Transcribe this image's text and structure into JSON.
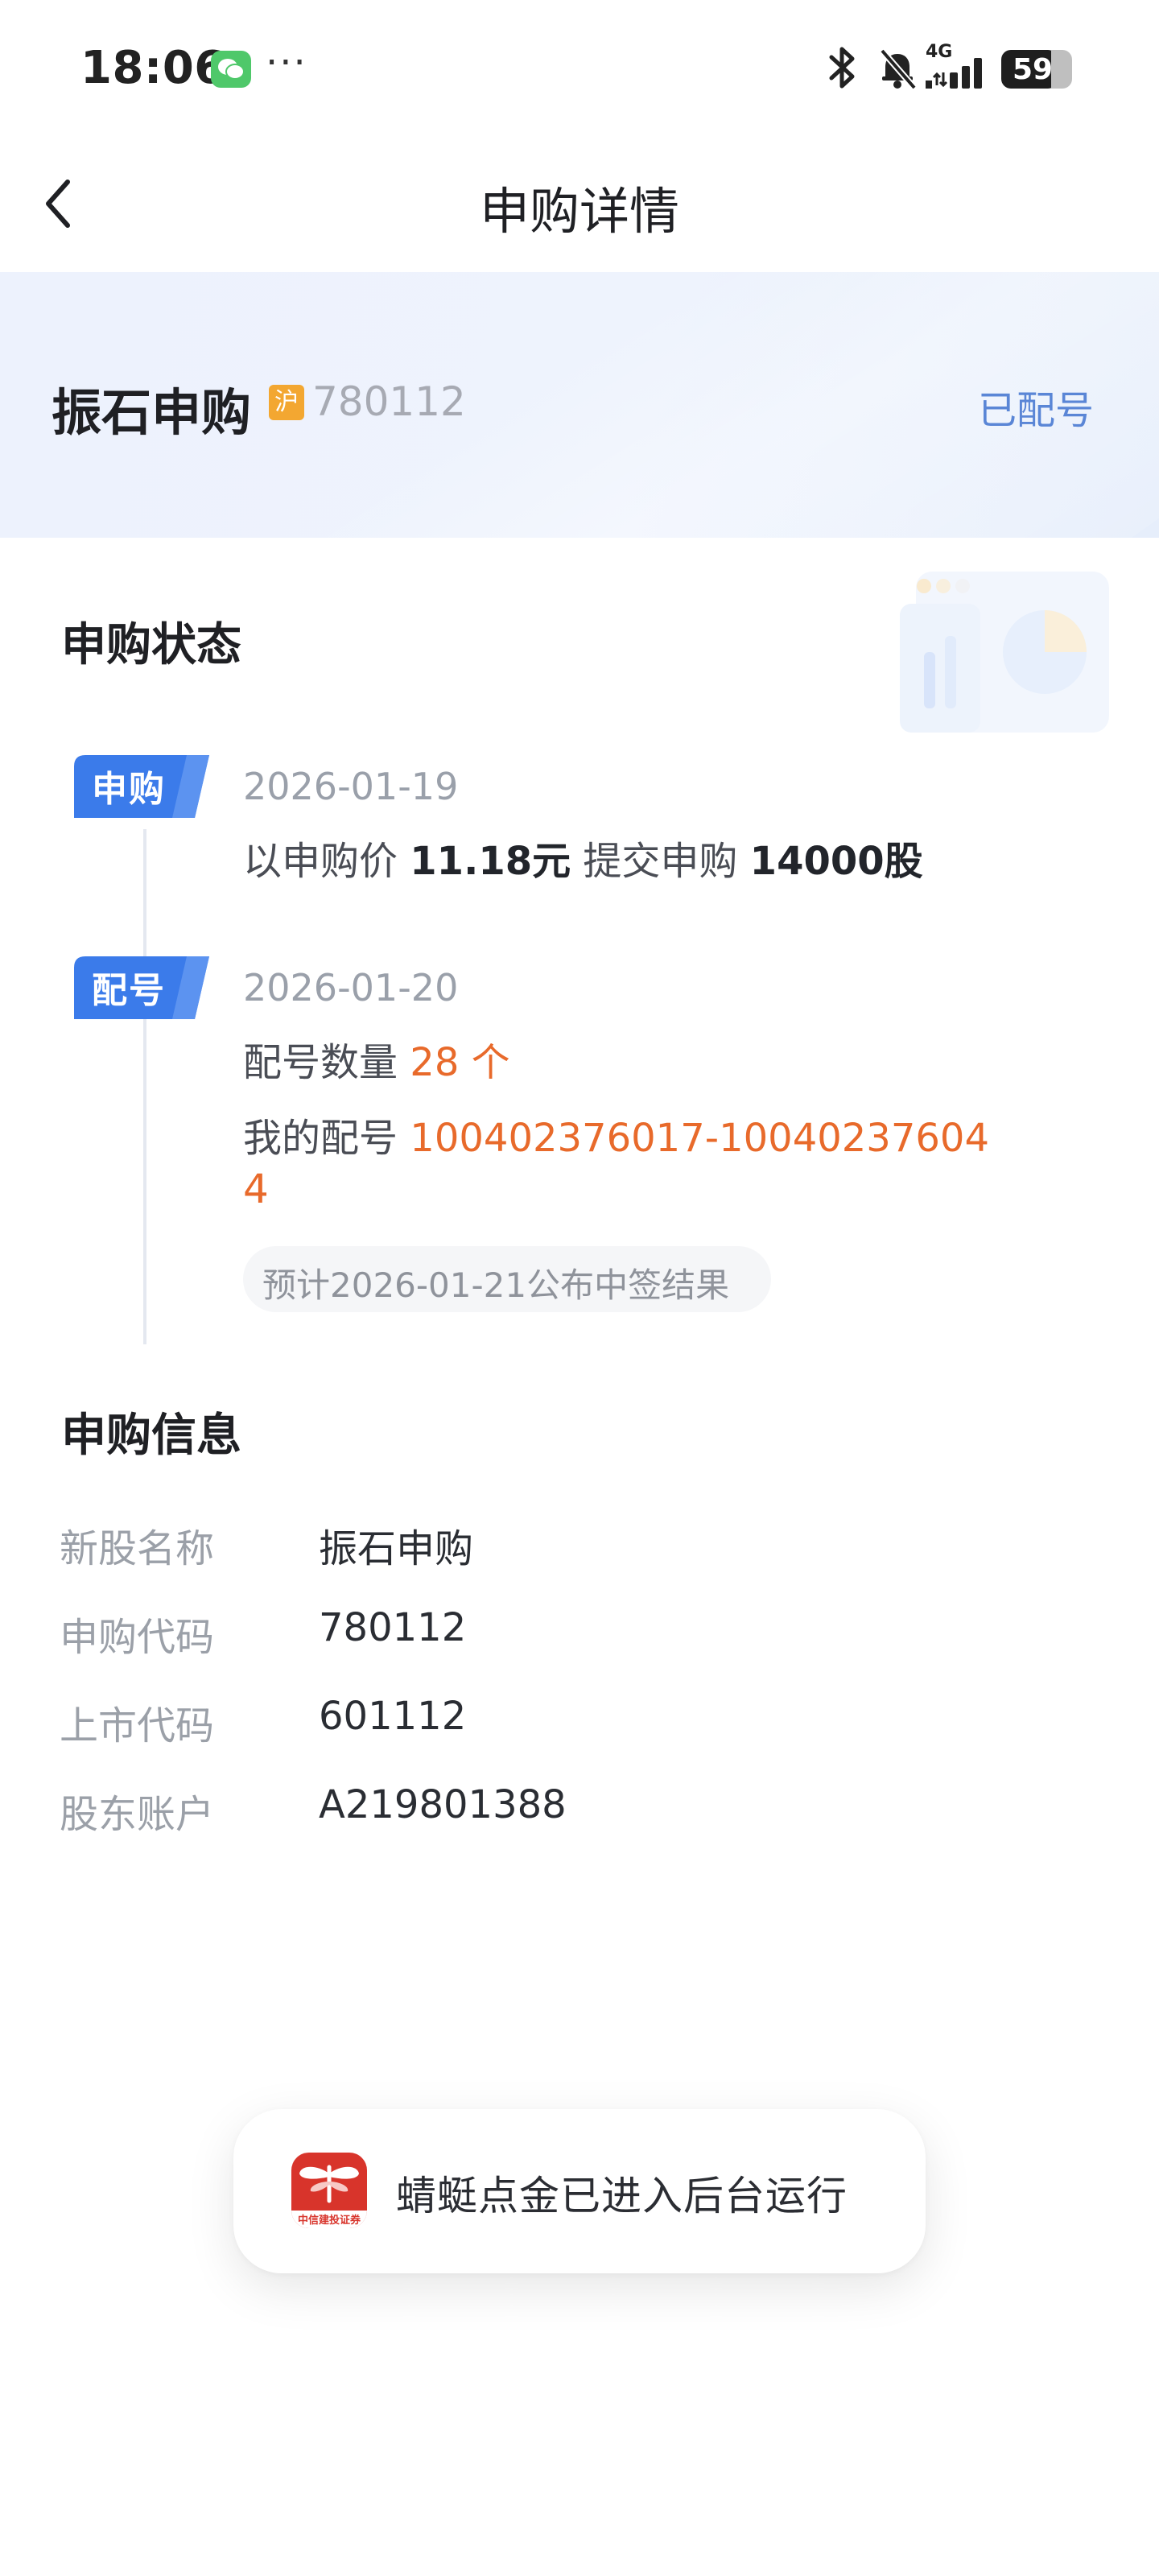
{
  "status_bar": {
    "time": "18:06",
    "more_dots": "···",
    "network_label": "4G",
    "battery_level": "59",
    "icons": [
      "wechat-icon",
      "bluetooth-icon",
      "mute-bell-icon",
      "signal-icon",
      "battery-icon"
    ]
  },
  "nav": {
    "title": "申购详情",
    "back_icon": "chevron-left-icon"
  },
  "stock": {
    "name": "振石申购",
    "market_badge": "沪",
    "code": "780112",
    "status": "已配号",
    "colors": {
      "badge": "#f3a731",
      "status": "#5a86d6"
    }
  },
  "status_section": {
    "title": "申购状态",
    "steps": [
      {
        "tag": "申购",
        "date": "2026-01-19",
        "line1_prefix": "以申购价",
        "price": "11.18元",
        "line1_middle": "提交申购",
        "shares": "14000股"
      },
      {
        "tag": "配号",
        "date": "2026-01-20",
        "count_label": "配号数量",
        "count_value": "28 个",
        "my_number_label": "我的配号",
        "my_number_value_line1": "100402376017-10040237604",
        "my_number_value_line2": "4",
        "hint": "预计2026-01-21公布中签结果"
      }
    ],
    "accent_color": "#e86a2b",
    "tag_color": "#3b7bea"
  },
  "info_section": {
    "title": "申购信息",
    "rows": [
      {
        "label": "新股名称",
        "value": "振石申购"
      },
      {
        "label": "申购代码",
        "value": "780112"
      },
      {
        "label": "上市代码",
        "value": "601112"
      },
      {
        "label": "股东账户",
        "value": "A219801388"
      }
    ]
  },
  "toast": {
    "text": "蜻蜓点金已进入后台运行",
    "logo_caption": "中信建投证券",
    "logo_color": "#d8342b"
  }
}
